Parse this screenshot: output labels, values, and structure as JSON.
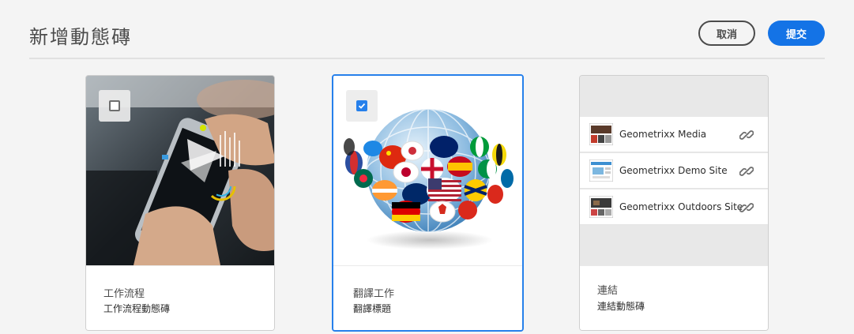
{
  "header": {
    "title": "新增動態磚",
    "cancel_label": "取消",
    "submit_label": "提交"
  },
  "cards": [
    {
      "title": "工作流程",
      "subtitle": "工作流程動態磚",
      "selected": false
    },
    {
      "title": "翻譯工作",
      "subtitle": "翻譯標題",
      "selected": true
    },
    {
      "title": "連結",
      "subtitle": "連結動態磚",
      "links": [
        "Geometrixx Media",
        "Geometrixx Demo Site",
        "Geometrixx Outdoors Site"
      ]
    }
  ],
  "colors": {
    "accent": "#1473e6",
    "selected_border": "#2680eb",
    "background": "#f4f4f4"
  },
  "icons": [
    "checkbox-unchecked-icon",
    "checkbox-checked-icon",
    "link-icon"
  ]
}
